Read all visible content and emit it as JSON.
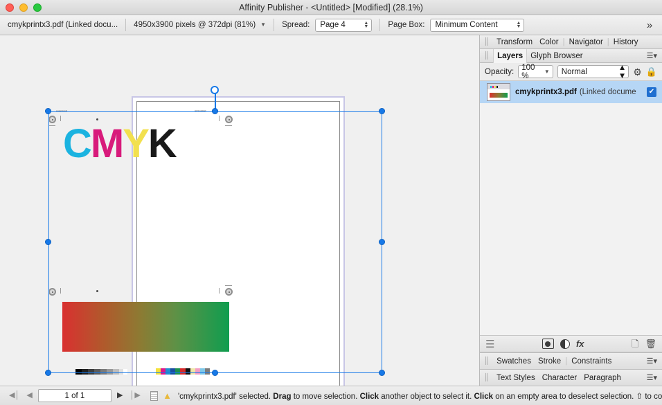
{
  "window": {
    "title": "Affinity Publisher - <Untitled> [Modified] (28.1%)",
    "traffic_lights": [
      "close",
      "minimize",
      "maximize"
    ]
  },
  "context_toolbar": {
    "document_label": "cmykprintx3.pdf (Linked docu...",
    "dimensions_label": "4950x3900 pixels @ 372dpi (81%)",
    "spread_label": "Spread:",
    "spread_value": "Page 4",
    "page_box_label": "Page Box:",
    "page_box_value": "Minimum Content",
    "overflow_icon": "»"
  },
  "canvas": {
    "artwork": {
      "cmyk_letters": [
        {
          "char": "C",
          "color": "#1bb3e0"
        },
        {
          "char": "M",
          "color": "#d81a7b"
        },
        {
          "char": "Y",
          "color": "#f2e04e"
        },
        {
          "char": "K",
          "color": "#191919"
        }
      ],
      "gradient_bar": {
        "from": "#d93030",
        "mid": "#8c7b33",
        "to": "#0f9d4f"
      },
      "color_strip_swatches": [
        "#f4e13a",
        "#e0168b",
        "#1f8fd0",
        "#1a4fa0",
        "#1f8f4f",
        "#d42a2a",
        "#111111",
        "#f0e6a8",
        "#f29ec4",
        "#7fc7e8",
        "#7c7c7c"
      ],
      "grayscale_strip": "10-step grayscale"
    },
    "selection": {
      "rotation_handle": "rotation-handle",
      "handle_color": "#1779e8"
    }
  },
  "right_panel": {
    "top_tabs": [
      {
        "label": "Transform",
        "active": false
      },
      {
        "label": "Color",
        "active": false
      },
      {
        "label": "Navigator",
        "active": false
      },
      {
        "label": "History",
        "active": false
      }
    ],
    "layers_tabs": [
      {
        "label": "Layers",
        "active": true
      },
      {
        "label": "Glyph Browser",
        "active": false
      }
    ],
    "opacity": {
      "label": "Opacity:",
      "value": "100 %",
      "blend_mode": "Normal",
      "gear_icon": "gear-icon",
      "lock_icon": "lock-icon"
    },
    "layers": [
      {
        "name": "cmykprintx3.pdf",
        "subtitle": "(Linked docume",
        "visible": true,
        "thumbnail": "pdf-thumbnail"
      }
    ],
    "layers_toolbar": {
      "stack_icon": "layer-stack-icon",
      "mask_icon": "add-mask-icon",
      "adjustment_icon": "adjustment-icon",
      "fx_label": "fx",
      "new_layer_icon": "new-layer-icon",
      "delete_icon": "trash-icon"
    },
    "bottom_tabs_1": [
      {
        "label": "Swatches",
        "active": false
      },
      {
        "label": "Stroke",
        "active": false
      },
      {
        "label": "Constraints",
        "active": false
      }
    ],
    "bottom_tabs_2": [
      {
        "label": "Text Styles",
        "active": false
      },
      {
        "label": "Character",
        "active": false
      },
      {
        "label": "Paragraph",
        "active": false
      }
    ]
  },
  "status_bar": {
    "page_indicator": "1 of 1",
    "first_icon": "◀│",
    "prev_icon": "◀",
    "next_icon": "▶",
    "last_icon": "│▶",
    "doc_icon": "document-icon",
    "warning_icon": "warning-bell-icon",
    "message_parts": [
      {
        "text": "'cmykprintx3.pdf' selected. ",
        "bold": false
      },
      {
        "text": "Drag",
        "bold": true
      },
      {
        "text": " to move selection. ",
        "bold": false
      },
      {
        "text": "Click",
        "bold": true
      },
      {
        "text": " another object to select it. ",
        "bold": false
      },
      {
        "text": "Click",
        "bold": true
      },
      {
        "text": " on an empty area to deselect selection. ⇧ to constrain. ⌘",
        "bold": false
      }
    ]
  }
}
